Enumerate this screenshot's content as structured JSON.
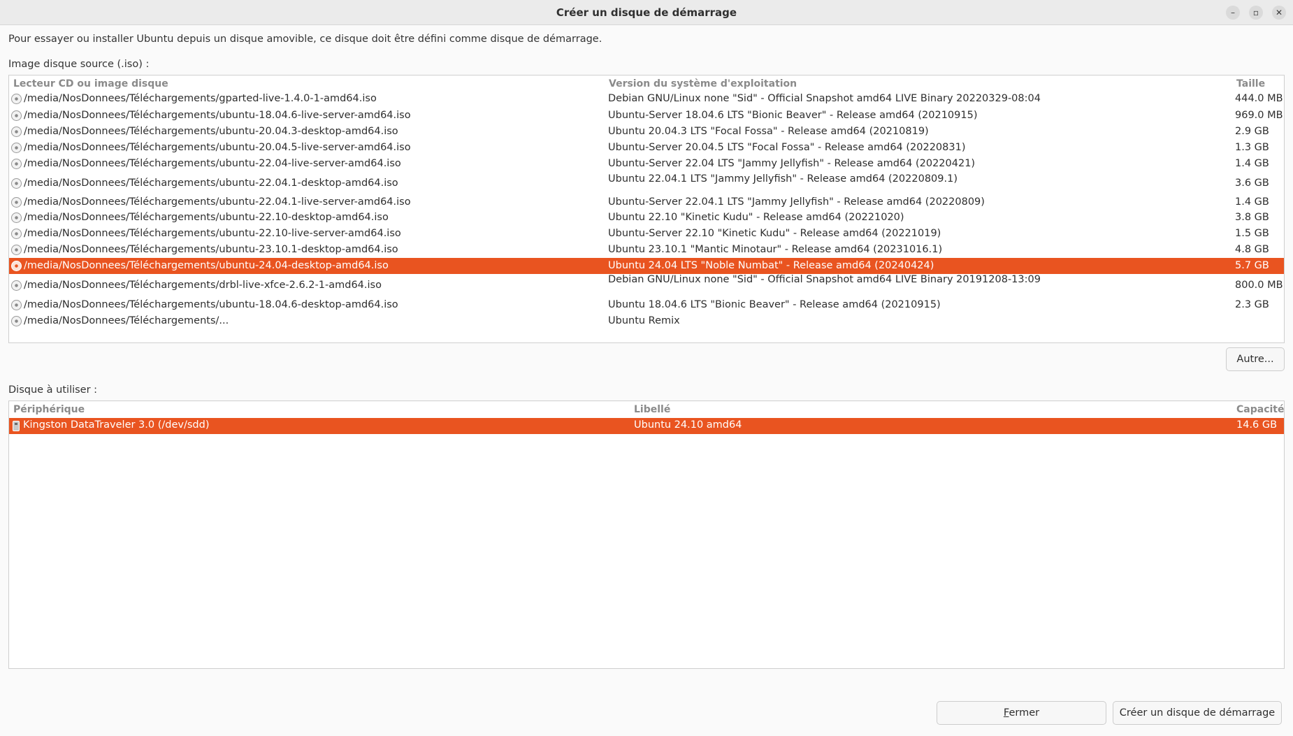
{
  "window": {
    "title": "Créer un disque de démarrage",
    "minimize_glyph": "–",
    "maximize_glyph": "▫",
    "close_glyph": "✕"
  },
  "intro": "Pour essayer ou installer Ubuntu depuis un disque amovible, ce disque doit être défini comme disque de démarrage.",
  "source": {
    "label": "Image disque source (.iso) :",
    "columns": {
      "image": "Lecteur CD ou image disque",
      "version": "Version du système d'exploitation",
      "size": "Taille"
    },
    "rows": [
      {
        "path": "/media/NosDonnees/Téléchargements/gparted-live-1.4.0-1-amd64.iso",
        "version": "Debian GNU/Linux none \"Sid\" - Official Snapshot amd64 LIVE Binary 20220329-08:04",
        "size": "444.0 MB"
      },
      {
        "path": "/media/NosDonnees/Téléchargements/ubuntu-18.04.6-live-server-amd64.iso",
        "version": "Ubuntu-Server 18.04.6 LTS \"Bionic Beaver\" - Release amd64 (20210915)",
        "size": "969.0 MB"
      },
      {
        "path": "/media/NosDonnees/Téléchargements/ubuntu-20.04.3-desktop-amd64.iso",
        "version": "Ubuntu 20.04.3 LTS \"Focal Fossa\" - Release amd64 (20210819)",
        "size": "2.9 GB"
      },
      {
        "path": "/media/NosDonnees/Téléchargements/ubuntu-20.04.5-live-server-amd64.iso",
        "version": "Ubuntu-Server 20.04.5 LTS \"Focal Fossa\" - Release amd64 (20220831)",
        "size": "1.3 GB"
      },
      {
        "path": "/media/NosDonnees/Téléchargements/ubuntu-22.04-live-server-amd64.iso",
        "version": "Ubuntu-Server 22.04 LTS \"Jammy Jellyfish\" - Release amd64 (20220421)",
        "size": "1.4 GB"
      },
      {
        "path": "/media/NosDonnees/Téléchargements/ubuntu-22.04.1-desktop-amd64.iso",
        "version": "Ubuntu 22.04.1 LTS \"Jammy Jellyfish\" - Release amd64 (20220809.1)",
        "size": "3.6 GB"
      },
      {
        "path": "/media/NosDonnees/Téléchargements/ubuntu-22.04.1-live-server-amd64.iso",
        "version": "Ubuntu-Server 22.04.1 LTS \"Jammy Jellyfish\" - Release amd64 (20220809)",
        "size": "1.4 GB"
      },
      {
        "path": "/media/NosDonnees/Téléchargements/ubuntu-22.10-desktop-amd64.iso",
        "version": "Ubuntu 22.10 \"Kinetic Kudu\" - Release amd64 (20221020)",
        "size": "3.8 GB"
      },
      {
        "path": "/media/NosDonnees/Téléchargements/ubuntu-22.10-live-server-amd64.iso",
        "version": "Ubuntu-Server 22.10 \"Kinetic Kudu\" - Release amd64 (20221019)",
        "size": "1.5 GB"
      },
      {
        "path": "/media/NosDonnees/Téléchargements/ubuntu-23.10.1-desktop-amd64.iso",
        "version": "Ubuntu 23.10.1 \"Mantic Minotaur\" - Release amd64 (20231016.1)",
        "size": "4.8 GB"
      },
      {
        "path": "/media/NosDonnees/Téléchargements/ubuntu-24.04-desktop-amd64.iso",
        "version": "Ubuntu 24.04 LTS \"Noble Numbat\" - Release amd64 (20240424)",
        "size": "5.7 GB",
        "selected": true
      },
      {
        "path": "/media/NosDonnees/Téléchargements/drbl-live-xfce-2.6.2-1-amd64.iso",
        "version": "Debian GNU/Linux none \"Sid\" - Official Snapshot amd64 LIVE Binary 20191208-13:09",
        "size": "800.0 MB"
      },
      {
        "path": "/media/NosDonnees/Téléchargements/ubuntu-18.04.6-desktop-amd64.iso",
        "version": "Ubuntu 18.04.6 LTS \"Bionic Beaver\" - Release amd64 (20210915)",
        "size": "2.3 GB"
      },
      {
        "path": "/media/NosDonnees/Téléchargements/...",
        "version": "Ubuntu Remix",
        "size": ""
      }
    ],
    "other_button": "Autre..."
  },
  "disk": {
    "label": "Disque à utiliser :",
    "columns": {
      "device": "Périphérique",
      "label": "Libellé",
      "capacity": "Capacité"
    },
    "rows": [
      {
        "device": "Kingston DataTraveler 3.0 (/dev/sdd)",
        "label": "Ubuntu 24.10 amd64",
        "capacity": "14.6 GB",
        "selected": true
      }
    ]
  },
  "buttons": {
    "close": "Fermer",
    "create": "Créer un disque de démarrage"
  },
  "colors": {
    "selection": "#e95420"
  }
}
